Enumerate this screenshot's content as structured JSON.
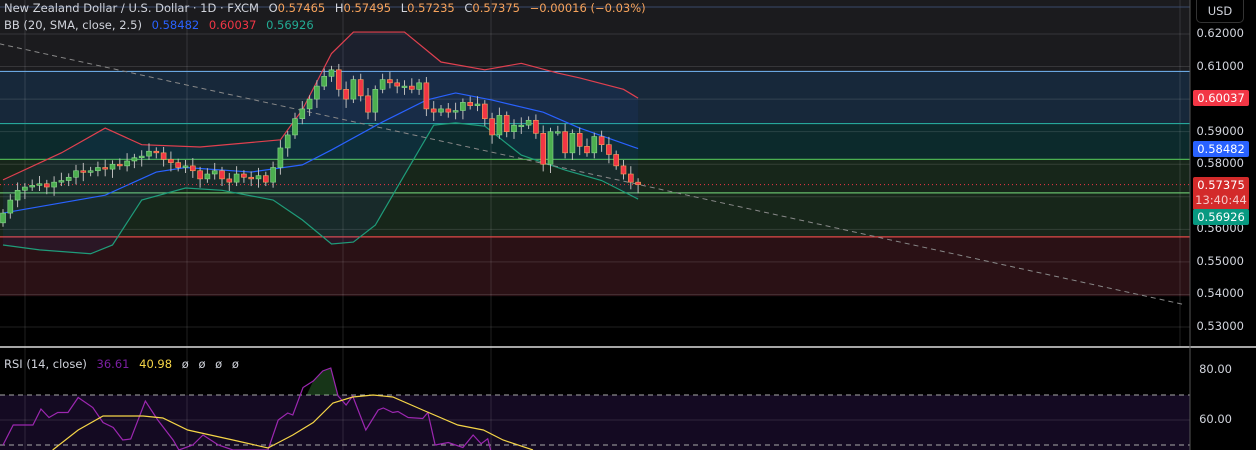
{
  "header": {
    "symbol": "New Zealand Dollar / U.S. Dollar · 1D · FXCM",
    "o_label": "O",
    "open": "0.57465",
    "h_label": "H",
    "high": "0.57495",
    "l_label": "L",
    "low": "0.57235",
    "c_label": "C",
    "close": "0.57375",
    "change": "−0.00016 (−0.03%)"
  },
  "bb_legend": {
    "label": "BB (20, SMA, close, 2.5)",
    "basis": "0.58482",
    "upper": "0.60037",
    "lower": "0.56926"
  },
  "rsi_legend": {
    "label": "RSI (14, close)",
    "rsi": "36.61",
    "ma": "40.98",
    "e1": "ø",
    "e2": "ø",
    "e3": "ø",
    "e4": "ø"
  },
  "price_axis": {
    "currency": "USD",
    "ticks": [
      "0.62000",
      "0.61000",
      "0.59000",
      "0.58000",
      "0.56000",
      "0.55000",
      "0.54000",
      "0.53000"
    ],
    "tick_values": [
      0.62,
      0.61,
      0.59,
      0.58,
      0.56,
      0.55,
      0.54,
      0.53
    ],
    "upper_badge": "0.60037",
    "basis_badge": "0.58482",
    "last_price_badge": "0.57375",
    "countdown": "13:40:44",
    "lower_badge": "0.56926"
  },
  "rsi_axis": {
    "ticks": [
      "80.00",
      "60.00"
    ],
    "tick_values": [
      80,
      60
    ]
  },
  "colors": {
    "up": "#4caf50",
    "down": "#f23645",
    "bb_upper": "#e0404f",
    "bb_basis": "#2962ff",
    "bb_lower": "#1f9c7a",
    "rsi": "#9c27b0",
    "rsi_ma": "#f5d547"
  },
  "chart_data": [
    {
      "type": "candlestick",
      "title": "NZD/USD 1D",
      "ylim": [
        0.5265,
        0.6255
      ],
      "closes": [
        0.565,
        0.569,
        0.572,
        0.573,
        0.5735,
        0.574,
        0.573,
        0.5745,
        0.575,
        0.576,
        0.578,
        0.5775,
        0.578,
        0.579,
        0.5785,
        0.58,
        0.5795,
        0.581,
        0.582,
        0.5825,
        0.584,
        0.5835,
        0.5815,
        0.5805,
        0.579,
        0.5795,
        0.578,
        0.5755,
        0.577,
        0.578,
        0.5755,
        0.5745,
        0.577,
        0.576,
        0.5755,
        0.5765,
        0.5745,
        0.579,
        0.585,
        0.589,
        0.594,
        0.597,
        0.6,
        0.604,
        0.607,
        0.609,
        0.603,
        0.6,
        0.606,
        0.601,
        0.596,
        0.603,
        0.606,
        0.605,
        0.604,
        0.604,
        0.603,
        0.605,
        0.597,
        0.596,
        0.597,
        0.596,
        0.5965,
        0.599,
        0.598,
        0.5985,
        0.594,
        0.589,
        0.595,
        0.59,
        0.592,
        0.592,
        0.5935,
        0.5895,
        0.58,
        0.59,
        0.59,
        0.5835,
        0.5895,
        0.5855,
        0.5835,
        0.5885,
        0.586,
        0.583,
        0.5795,
        0.577,
        0.5745,
        0.57375
      ],
      "bb_upper": [
        [
          0,
          0.5752
        ],
        [
          8,
          0.5835
        ],
        [
          14,
          0.5911
        ],
        [
          19,
          0.586
        ],
        [
          27,
          0.5853
        ],
        [
          38,
          0.5875
        ],
        [
          41,
          0.5967
        ],
        [
          45,
          0.614
        ],
        [
          48,
          0.6206
        ],
        [
          55,
          0.6206
        ],
        [
          60,
          0.6114
        ],
        [
          66,
          0.609
        ],
        [
          71,
          0.611
        ],
        [
          76,
          0.608
        ],
        [
          79,
          0.6065
        ],
        [
          85,
          0.603
        ],
        [
          87,
          0.6003
        ]
      ],
      "bb_basis": [
        [
          0,
          0.565
        ],
        [
          14,
          0.5705
        ],
        [
          21,
          0.5776
        ],
        [
          25,
          0.579
        ],
        [
          34,
          0.5776
        ],
        [
          41,
          0.5798
        ],
        [
          45,
          0.5844
        ],
        [
          52,
          0.593
        ],
        [
          58,
          0.5997
        ],
        [
          62,
          0.6019
        ],
        [
          67,
          0.5997
        ],
        [
          74,
          0.596
        ],
        [
          79,
          0.5911
        ],
        [
          87,
          0.5848
        ]
      ],
      "bb_lower": [
        [
          0,
          0.5552
        ],
        [
          5,
          0.5537
        ],
        [
          12,
          0.5525
        ],
        [
          15,
          0.5552
        ],
        [
          19,
          0.569
        ],
        [
          25,
          0.5727
        ],
        [
          30,
          0.572
        ],
        [
          37,
          0.569
        ],
        [
          41,
          0.5629
        ],
        [
          45,
          0.5555
        ],
        [
          48,
          0.5561
        ],
        [
          51,
          0.5613
        ],
        [
          55,
          0.5767
        ],
        [
          59,
          0.592
        ],
        [
          62,
          0.5927
        ],
        [
          66,
          0.5917
        ],
        [
          71,
          0.5828
        ],
        [
          77,
          0.5782
        ],
        [
          82,
          0.575
        ],
        [
          87,
          0.5693
        ]
      ],
      "levels": [
        0.6085,
        0.5925,
        0.5815,
        0.5712,
        0.5577
      ],
      "zones": [
        [
          0.6085,
          0.5925,
          "blue"
        ],
        [
          0.5925,
          0.5815,
          "teal"
        ],
        [
          0.5815,
          0.5577,
          "green"
        ],
        [
          0.5577,
          0.5395,
          "red"
        ]
      ],
      "trendline": [
        [
          -0.5,
          0.617
        ],
        [
          162,
          0.5368
        ]
      ]
    },
    {
      "type": "line",
      "title": "RSI (14, close)",
      "ylim": [
        40,
        89
      ],
      "bands": [
        70,
        50
      ],
      "rsi": [
        [
          0,
          50
        ],
        [
          1.4,
          58
        ],
        [
          4.1,
          58
        ],
        [
          5.2,
          64.4
        ],
        [
          6.3,
          61
        ],
        [
          7.5,
          63
        ],
        [
          8.9,
          63
        ],
        [
          10.3,
          69
        ],
        [
          12.3,
          65
        ],
        [
          13.7,
          59
        ],
        [
          15.1,
          57
        ],
        [
          16.4,
          52
        ],
        [
          17.5,
          52.4
        ],
        [
          19.5,
          67.6
        ],
        [
          21.2,
          60
        ],
        [
          23.3,
          52
        ],
        [
          24.1,
          48
        ],
        [
          26,
          50
        ],
        [
          27.4,
          54
        ],
        [
          29.5,
          50
        ],
        [
          31.5,
          48
        ],
        [
          36.3,
          48
        ],
        [
          37.7,
          60
        ],
        [
          39,
          62.8
        ],
        [
          39.7,
          62
        ],
        [
          41.1,
          73
        ],
        [
          42.5,
          75.6
        ],
        [
          43.8,
          79.6
        ],
        [
          44.9,
          80.8
        ],
        [
          45.9,
          69.6
        ],
        [
          47,
          66
        ],
        [
          47.9,
          69.6
        ],
        [
          49.7,
          56
        ],
        [
          51.4,
          64
        ],
        [
          52.1,
          64.8
        ],
        [
          53.4,
          63
        ],
        [
          54.1,
          63.4
        ],
        [
          55.5,
          61
        ],
        [
          57.5,
          60.6
        ],
        [
          58.2,
          63
        ],
        [
          59.2,
          50
        ],
        [
          61,
          51
        ],
        [
          63,
          49
        ],
        [
          64.4,
          54
        ],
        [
          65.5,
          50.5
        ],
        [
          66.4,
          52.5
        ],
        [
          66.8,
          48
        ]
      ],
      "rsi_ma": [
        [
          6.8,
          48
        ],
        [
          10.3,
          56
        ],
        [
          13.7,
          61.6
        ],
        [
          19.2,
          61.6
        ],
        [
          21.9,
          60.8
        ],
        [
          25.3,
          56
        ],
        [
          31.5,
          52
        ],
        [
          36.3,
          48.8
        ],
        [
          39.7,
          54
        ],
        [
          42.5,
          59
        ],
        [
          45.2,
          66.8
        ],
        [
          47.9,
          69.2
        ],
        [
          50.7,
          70
        ],
        [
          53.4,
          69.2
        ],
        [
          57.5,
          64
        ],
        [
          62.3,
          58
        ],
        [
          65.8,
          56
        ],
        [
          68.5,
          52
        ],
        [
          72.6,
          48
        ]
      ]
    }
  ]
}
